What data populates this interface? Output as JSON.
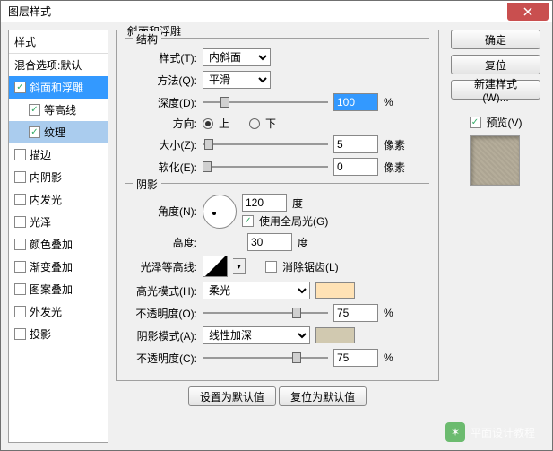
{
  "title": "图层样式",
  "sidebar": {
    "header": "样式",
    "blend": "混合选项:默认",
    "items": [
      {
        "label": "斜面和浮雕",
        "checked": true,
        "selected": true
      },
      {
        "label": "等高线",
        "checked": true,
        "sub": true
      },
      {
        "label": "纹理",
        "checked": true,
        "sub": true,
        "selected": true
      },
      {
        "label": "描边",
        "checked": false
      },
      {
        "label": "内阴影",
        "checked": false
      },
      {
        "label": "内发光",
        "checked": false
      },
      {
        "label": "光泽",
        "checked": false
      },
      {
        "label": "颜色叠加",
        "checked": false
      },
      {
        "label": "渐变叠加",
        "checked": false
      },
      {
        "label": "图案叠加",
        "checked": false
      },
      {
        "label": "外发光",
        "checked": false
      },
      {
        "label": "投影",
        "checked": false
      }
    ]
  },
  "section_title": "斜面和浮雕",
  "structure": {
    "legend": "结构",
    "style_label": "样式(T):",
    "style_value": "内斜面",
    "technique_label": "方法(Q):",
    "technique_value": "平滑",
    "depth_label": "深度(D):",
    "depth_value": "100",
    "depth_unit": "%",
    "direction_label": "方向:",
    "up": "上",
    "down": "下",
    "size_label": "大小(Z):",
    "size_value": "5",
    "size_unit": "像素",
    "soften_label": "软化(E):",
    "soften_value": "0",
    "soften_unit": "像素"
  },
  "shading": {
    "legend": "阴影",
    "angle_label": "角度(N):",
    "angle_value": "120",
    "angle_unit": "度",
    "global_label": "使用全局光(G)",
    "altitude_label": "高度:",
    "altitude_value": "30",
    "altitude_unit": "度",
    "gloss_label": "光泽等高线:",
    "antialias_label": "消除锯齿(L)",
    "highlight_mode_label": "高光模式(H):",
    "highlight_mode_value": "柔光",
    "highlight_color": "#ffe2b5",
    "highlight_opacity_label": "不透明度(O):",
    "highlight_opacity_value": "75",
    "shadow_mode_label": "阴影模式(A):",
    "shadow_mode_value": "线性加深",
    "shadow_color": "#d1c9b0",
    "shadow_opacity_label": "不透明度(C):",
    "shadow_opacity_value": "75",
    "opacity_unit": "%"
  },
  "bottom": {
    "default": "设置为默认值",
    "reset": "复位为默认值"
  },
  "right": {
    "ok": "确定",
    "cancel": "复位",
    "new_style": "新建样式(W)...",
    "preview_label": "预览(V)"
  },
  "watermark": "平面设计教程"
}
